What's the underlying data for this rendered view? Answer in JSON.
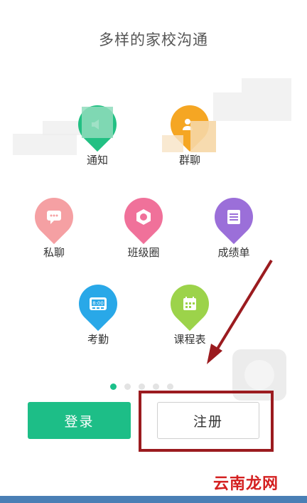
{
  "header": {
    "title": "多样的家校沟通"
  },
  "features": [
    {
      "label": "通知",
      "icon": "notification-icon",
      "color": "#22c083"
    },
    {
      "label": "群聊",
      "icon": "group-chat-icon",
      "color": "#f5a623"
    },
    {
      "label": "私聊",
      "icon": "private-chat-icon",
      "color": "#f5a0a3"
    },
    {
      "label": "班级圈",
      "icon": "class-circle-icon",
      "color": "#f0719a"
    },
    {
      "label": "成绩单",
      "icon": "report-card-icon",
      "color": "#9b6fd9"
    },
    {
      "label": "考勤",
      "icon": "attendance-icon",
      "color": "#29a8e8",
      "clock_text": "8:00"
    },
    {
      "label": "课程表",
      "icon": "schedule-icon",
      "color": "#9cd34a"
    }
  ],
  "pager": {
    "count": 5,
    "active": 1
  },
  "actions": {
    "login_label": "登录",
    "register_label": "注册"
  },
  "annotation": {
    "color": "#9b1b1f"
  },
  "watermark": {
    "text": "云南龙网"
  }
}
